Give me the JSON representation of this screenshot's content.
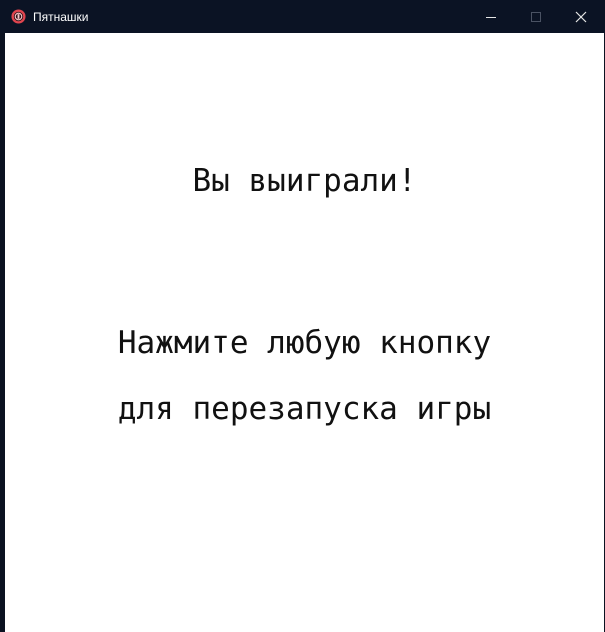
{
  "window": {
    "title": "Пятнашки",
    "icon": "app-logo-icon",
    "controls": {
      "minimize_icon": "minimize-icon",
      "maximize_icon": "maximize-icon",
      "close_icon": "close-icon"
    }
  },
  "game": {
    "win_message": "Вы выиграли!",
    "restart_line1": "Нажмите любую кнопку",
    "restart_line2": "для перезапуска игры"
  },
  "colors": {
    "titlebar": "#0b1324",
    "background": "#ffffff",
    "text": "#111111",
    "icon_accent": "#e0454f"
  }
}
